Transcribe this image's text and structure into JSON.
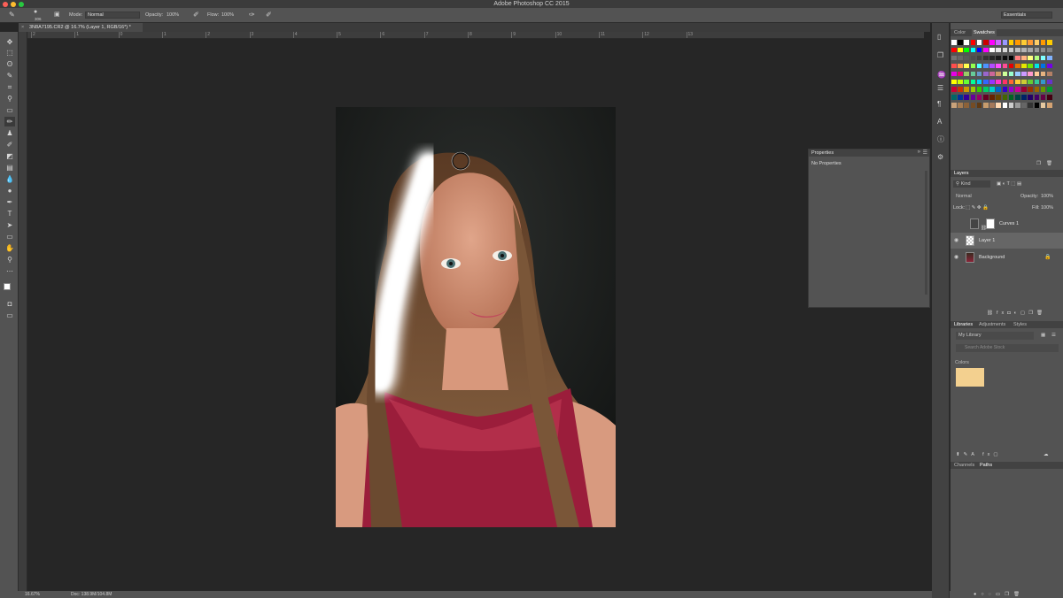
{
  "window": {
    "title": "Adobe Photoshop CC 2015",
    "workspace": "Essentials"
  },
  "options": {
    "brush_size": "306",
    "mode_label": "Mode:",
    "mode_value": "Normal",
    "opacity_label": "Opacity:",
    "opacity_value": "100%",
    "flow_label": "Flow:",
    "flow_value": "100%"
  },
  "document": {
    "tab_title": "3N8A7195.CR2 @ 16.7% (Layer 1, RGB/16*) *"
  },
  "ruler": {
    "labels": [
      "2",
      "1",
      "0",
      "1",
      "2",
      "3",
      "4",
      "5",
      "6",
      "7",
      "8",
      "9",
      "10",
      "11",
      "12",
      "13"
    ]
  },
  "status": {
    "zoom": "16.67%",
    "doc_info": "Doc: 138.9M/104.8M"
  },
  "properties": {
    "title": "Properties",
    "body": "No Properties"
  },
  "swatches": {
    "tabs": [
      "Color",
      "Swatches"
    ],
    "active": "Swatches"
  },
  "layers": {
    "title": "Layers",
    "kind_label": "Kind",
    "blend_mode": "Normal",
    "opacity_label": "Opacity:",
    "opacity_value": "100%",
    "lock_label": "Lock:",
    "fill_label": "Fill:",
    "fill_value": "100%",
    "items": [
      {
        "name": "Curves 1",
        "visible": false,
        "selected": false
      },
      {
        "name": "Layer 1",
        "visible": true,
        "selected": true
      },
      {
        "name": "Background",
        "visible": true,
        "selected": false
      }
    ]
  },
  "libraries": {
    "tabs": [
      "Libraries",
      "Adjustments",
      "Styles"
    ],
    "active": "Libraries",
    "library_name": "My Library",
    "search_placeholder": "Search Adobe Stock",
    "colors_label": "Colors",
    "color_swatch": "#f3d08f"
  },
  "channels": {
    "tabs": [
      "Channels",
      "Paths"
    ],
    "active": "Paths"
  }
}
